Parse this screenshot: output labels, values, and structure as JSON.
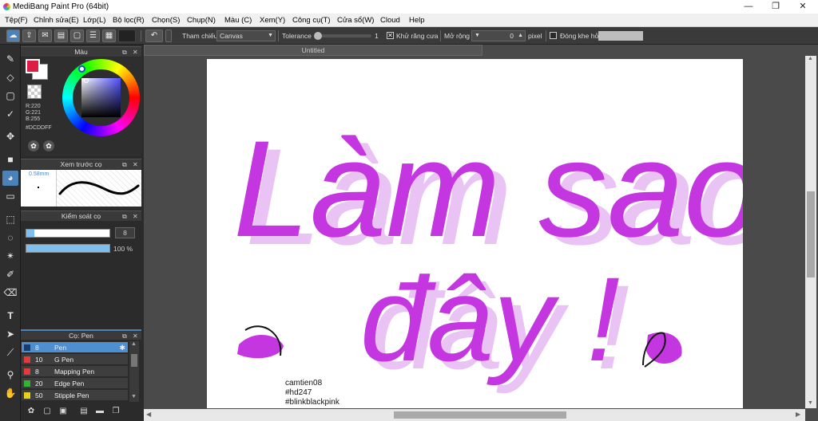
{
  "window": {
    "title": "MediBang Paint Pro (64bit)",
    "controls": [
      "—",
      "❐",
      "✕"
    ]
  },
  "menu": [
    "Tệp(F)",
    "Chỉnh sửa(E)",
    "Lớp(L)",
    "Bộ lọc(R)",
    "Chọn(S)",
    "Chụp(N)",
    "Màu (C)",
    "Xem(Y)",
    "Công cụ(T)",
    "Cửa sổ(W)",
    "Cloud",
    "Help"
  ],
  "toolbar": {
    "reference_label": "Tham chiếu",
    "reference_value": "Canvas",
    "tolerance_label": "Tolerance",
    "tolerance_value": "1",
    "tolerance_level": 0.0,
    "antialias_label": "Khử răng cưa",
    "antialias_checked": true,
    "expand_label": "Mở rộng",
    "expand_value": "0",
    "expand_unit": "pixel",
    "close_gap_label": "Đóng khe hở",
    "close_gap_checked": false
  },
  "color_panel": {
    "title": "Màu",
    "r": "R:220",
    "g": "G:221",
    "b": "B:255",
    "hex": "#DCDDFF",
    "primary_color": "#dc1e46",
    "hue_color": "#5050ff"
  },
  "brush_preview": {
    "title": "Xem trước cọ",
    "size": "0.58mm"
  },
  "brush_control": {
    "title": "Kiểm soát cọ",
    "size_value": "8",
    "size_level": 0.1,
    "opacity_value": "100 %",
    "opacity_level": 1.0
  },
  "brush_list": {
    "title": "Cọ: Pen",
    "items": [
      {
        "size": "8",
        "name": "Pen",
        "color": "#1a3a6a",
        "selected": true
      },
      {
        "size": "10",
        "name": "G Pen",
        "color": "#e33b3b",
        "selected": false
      },
      {
        "size": "8",
        "name": "Mapping Pen",
        "color": "#e33b3b",
        "selected": false
      },
      {
        "size": "20",
        "name": "Edge Pen",
        "color": "#2fb52f",
        "selected": false
      },
      {
        "size": "50",
        "name": "Stipple Pen",
        "color": "#e6d21e",
        "selected": false
      }
    ]
  },
  "document": {
    "tab_title": "Untitled"
  },
  "artwork": {
    "line1": "Làm sao",
    "line2": "đây !",
    "ink_color": "#c436e0",
    "shadow_color": "#e9c3f4",
    "signature": [
      "camtien08",
      "#hd247",
      "#blinkblackpink"
    ]
  }
}
